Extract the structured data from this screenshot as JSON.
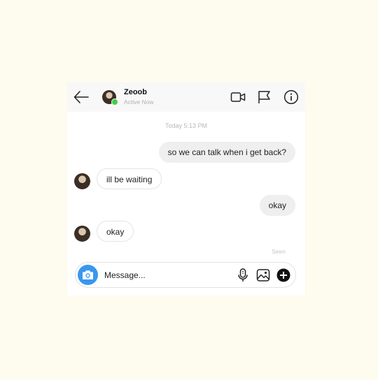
{
  "header": {
    "contact_name": "Zeoob",
    "contact_status": "Active Now",
    "icons": [
      "back-arrow-icon",
      "avatar",
      "video-call-icon",
      "flag-icon",
      "info-icon"
    ]
  },
  "conversation": {
    "timestamp": "Today 5:13 PM",
    "messages": [
      {
        "sender": "me",
        "text": "so we can talk when i get back?"
      },
      {
        "sender": "them",
        "text": "ill be waiting"
      },
      {
        "sender": "me",
        "text": "okay"
      },
      {
        "sender": "them",
        "text": "okay"
      }
    ],
    "seen_label": "Seen"
  },
  "composer": {
    "placeholder": "Message...",
    "icons": [
      "camera-icon",
      "microphone-icon",
      "image-icon",
      "plus-icon"
    ]
  },
  "colors": {
    "page_background": "#fefbef",
    "header_background": "#f8f8f8",
    "online_indicator": "#3ecf4a",
    "camera_button": "#3897f0",
    "sent_bubble": "#efefef"
  }
}
